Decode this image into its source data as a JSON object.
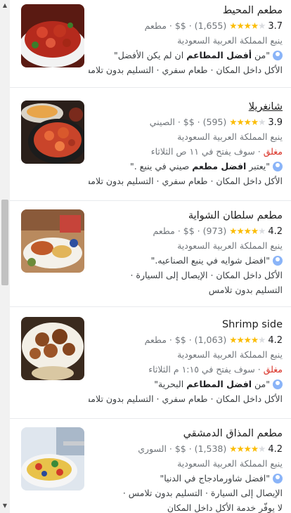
{
  "results": [
    {
      "name": "مطعم المحيط",
      "rating": "3.7",
      "stars_filled": 4,
      "review_count": "(1,655)",
      "price": "$$",
      "category": "مطعم",
      "location": "ينبع المملكة العربية السعودية",
      "status_closed": "",
      "status_rest": "",
      "review_pre": "\"من ",
      "review_bold": "أفضل المطاعم",
      "review_post": " ان لم يكن الأفضل\"",
      "services": "الأكل داخل المكان · طعام سفري · التسليم بدون تلامس",
      "services2": "",
      "underlined": false
    },
    {
      "name": "شانغريلا",
      "rating": "3.9",
      "stars_filled": 4,
      "review_count": "(595)",
      "price": "$$",
      "category": "الصيني",
      "location": "ينبع المملكة العربية السعودية",
      "status_closed": "مغلق",
      "status_rest": " · سوف يفتح في ١١ ص الثلاثاء",
      "review_pre": "\"يعتبر ",
      "review_bold": "افضل مطعم",
      "review_post": " صيني في ينبع .\"",
      "services": "الأكل داخل المكان · طعام سفري · التسليم بدون تلامس",
      "services2": "",
      "underlined": true
    },
    {
      "name": "مطعم سلطان الشواية",
      "rating": "4.2",
      "stars_filled": 4,
      "review_count": "(973)",
      "price": "$$",
      "category": "مطعم",
      "location": "ينبع المملكة العربية السعودية",
      "status_closed": "",
      "status_rest": "",
      "review_pre": "\"افضل شوايه في ينبع الصناعيه.\"",
      "review_bold": "",
      "review_post": "",
      "services": "الأكل داخل المكان · الإيصال إلى السيارة ·",
      "services2": "التسليم بدون تلامس",
      "underlined": false
    },
    {
      "name": "Shrimp side",
      "rating": "4.2",
      "stars_filled": 4,
      "review_count": "(1,063)",
      "price": "$$",
      "category": "مطعم",
      "location": "ينبع المملكة العربية السعودية",
      "status_closed": "مغلق",
      "status_rest": " · سوف يفتح في ١:١٥ م الثلاثاء",
      "review_pre": "\"من ",
      "review_bold": "افضل المطاعم",
      "review_post": " البحرية\"",
      "services": "الأكل داخل المكان · طعام سفري · التسليم بدون تلامس",
      "services2": "",
      "underlined": false
    },
    {
      "name": "مطعم المذاق الدمشقي",
      "rating": "4.2",
      "stars_filled": 4,
      "review_count": "(1,538)",
      "price": "$$",
      "category": "السوري",
      "location": "ينبع المملكة العربية السعودية",
      "status_closed": "",
      "status_rest": "",
      "review_pre": "\"افضل شاورمادجاج في الدنيا\"",
      "review_bold": "",
      "review_post": "",
      "services": "الإيصال إلى السيارة · التسليم بدون تلامس ·",
      "services2": "لا يوفّر خدمة الأكل داخل المكان",
      "underlined": false
    }
  ],
  "icons": {
    "star": "star-icon",
    "avatar": "user-avatar-icon"
  },
  "colors": {
    "star": "#fbbc04",
    "closed": "#d93025",
    "muted": "#70757a"
  }
}
